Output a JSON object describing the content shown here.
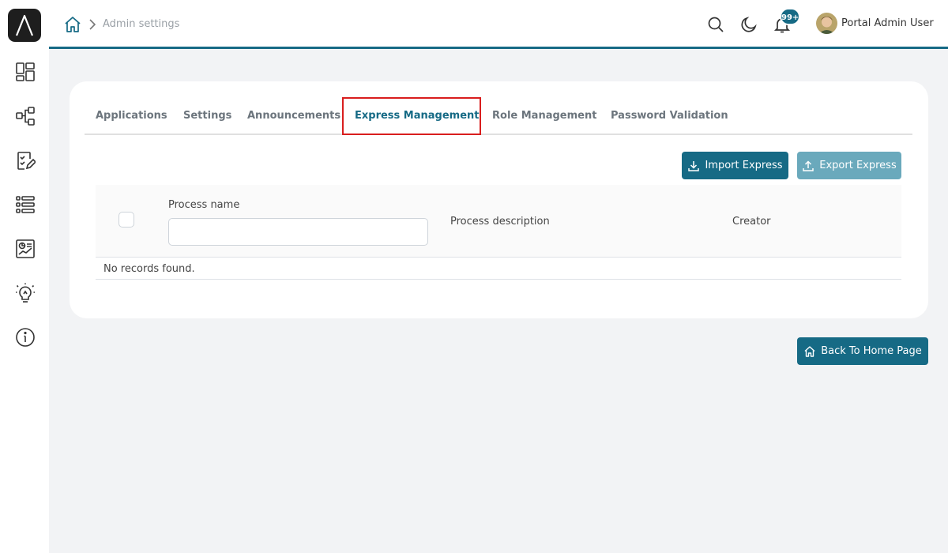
{
  "breadcrumb": {
    "current": "Admin settings"
  },
  "header": {
    "notification_count": "99+",
    "user_name": "Portal Admin User"
  },
  "tabs": [
    {
      "label": "Applications"
    },
    {
      "label": "Settings"
    },
    {
      "label": "Announcements"
    },
    {
      "label": "Express Management"
    },
    {
      "label": "Role Management"
    },
    {
      "label": "Password Validation"
    }
  ],
  "actions": {
    "import_label": "Import Express",
    "export_label": "Export Express"
  },
  "table": {
    "columns": {
      "process_name": "Process name",
      "process_description": "Process description",
      "creator": "Creator"
    },
    "filter_value": "",
    "empty_message": "No records found."
  },
  "footer": {
    "back_label": "Back To Home Page"
  },
  "colors": {
    "primary": "#166a85",
    "primary_light": "#6aa9bc",
    "highlight_border": "#d91e1e"
  },
  "icons": {
    "sidebar": [
      "dashboard-icon",
      "process-flow-icon",
      "task-check-icon",
      "list-icon",
      "statistics-icon",
      "lightbulb-icon",
      "info-icon"
    ],
    "header": [
      "home-icon",
      "search-icon",
      "moon-icon",
      "bell-icon"
    ]
  }
}
